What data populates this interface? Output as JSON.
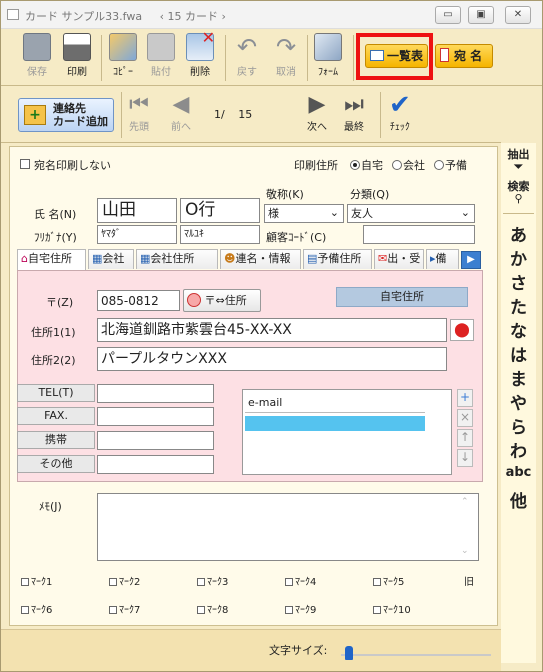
{
  "window": {
    "title": "カード サンプル33.fwa",
    "card_counter": "‹ 15 カード ›",
    "minimize": "▭",
    "maximize": "▣",
    "close": "✕"
  },
  "toolbar": {
    "save": "保存",
    "print": "印刷",
    "copy": "ｺﾋﾟｰ",
    "paste": "貼付",
    "delete": "削除",
    "undo": "戻す",
    "cancel": "取消",
    "form": "ﾌｫｰﾑ",
    "list_view": "一覧表",
    "address": "宛 名"
  },
  "navbar": {
    "add_contact": "連絡先\nカード追加",
    "first": "先頭",
    "prev": "前へ",
    "page_current": "1/",
    "page_total": "15",
    "next": "次へ",
    "last": "最終",
    "check": "ﾁｪｯｸ"
  },
  "form": {
    "no_address_print_label": "宛名印刷しない",
    "print_address_label": "印刷住所",
    "print_address_options": [
      "自宅",
      "会社",
      "予備"
    ],
    "print_address_selected": "自宅",
    "name_label": "氏 名(N)",
    "surname": "山田",
    "given_name": "O行",
    "furigana_label": "ﾌﾘｶﾞﾅ(Y)",
    "surname_kana": "ﾔﾏﾀﾞ",
    "given_name_kana": "ﾏﾙﾕｷ",
    "honorific_label": "敬称(K)",
    "honorific_value": "様",
    "category_label": "分類(Q)",
    "category_value": "友人",
    "customer_code_label": "顧客ｺｰﾄﾞ(C)",
    "customer_code_value": ""
  },
  "tabs": [
    "自宅住所",
    "会社",
    "会社住所",
    "連名・情報",
    "予備住所",
    "出・受",
    "備"
  ],
  "home_address": {
    "zip_label": "〒(Z)",
    "zip_value": "085-0812",
    "zip_convert_button": "〒⇔住所",
    "address_type_button": "自宅住所",
    "addr1_label": "住所1(1)",
    "addr1_value": "北海道釧路市紫雲台45-XX-XX",
    "addr2_label": "住所2(2)",
    "addr2_value": "パープルタウンXXX",
    "tel_label": "TEL(T)",
    "fax_label": "FAX.",
    "mobile_label": "携帯",
    "other_label": "その他",
    "email_item": "e-mail"
  },
  "memo": {
    "label": "ﾒﾓ(J)",
    "value": ""
  },
  "marks": [
    "ﾏｰｸ1",
    "ﾏｰｸ2",
    "ﾏｰｸ3",
    "ﾏｰｸ4",
    "ﾏｰｸ5",
    "ﾏｰｸ6",
    "ﾏｰｸ7",
    "ﾏｰｸ8",
    "ﾏｰｸ9",
    "ﾏｰｸ10"
  ],
  "marks_more": "旧",
  "index_bar": {
    "extract": "抽出",
    "search": "検索",
    "items": [
      "あ",
      "か",
      "さ",
      "た",
      "な",
      "は",
      "ま",
      "や",
      "ら",
      "わ",
      "abc",
      "他"
    ]
  },
  "status": {
    "font_size_label": "文字サイズ:"
  },
  "colors": {
    "highlight_box": "#e11111",
    "pink_panel": "#fde0e4",
    "selected_list_row": "#55c3ef"
  }
}
